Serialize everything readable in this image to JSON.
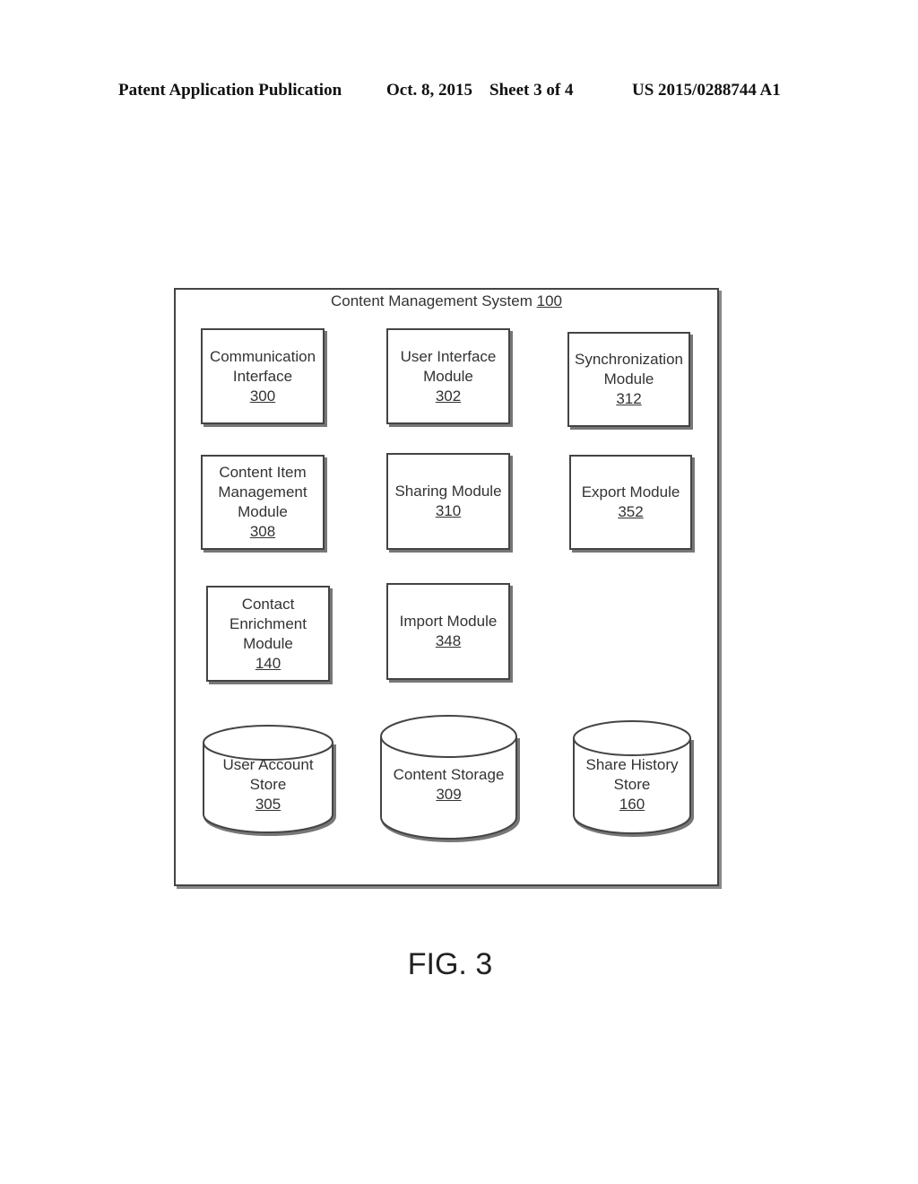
{
  "header": {
    "left": "Patent Application Publication",
    "date_sheet": "Oct. 8, 2015    Sheet 3 of 4",
    "number": "US 2015/0288744 A1"
  },
  "system": {
    "title": "Content Management System",
    "ref": "100"
  },
  "modules": [
    {
      "lines": [
        "Communication",
        "Interface"
      ],
      "ref": "300"
    },
    {
      "lines": [
        "User Interface",
        "Module"
      ],
      "ref": "302"
    },
    {
      "lines": [
        "Synchronization",
        "Module"
      ],
      "ref": "312"
    },
    {
      "lines": [
        "Content Item",
        "Management",
        "Module"
      ],
      "ref": "308"
    },
    {
      "lines": [
        "Sharing Module"
      ],
      "ref": "310"
    },
    {
      "lines": [
        "Export Module"
      ],
      "ref": "352"
    },
    {
      "lines": [
        "Contact",
        "Enrichment",
        "Module"
      ],
      "ref": "140"
    },
    {
      "lines": [
        "Import Module"
      ],
      "ref": "348"
    }
  ],
  "stores": [
    {
      "lines": [
        "User Account",
        "Store"
      ],
      "ref": "305"
    },
    {
      "lines": [
        "Content Storage"
      ],
      "ref": "309"
    },
    {
      "lines": [
        "Share History",
        "Store"
      ],
      "ref": "160"
    }
  ],
  "figure_label": "FIG. 3"
}
